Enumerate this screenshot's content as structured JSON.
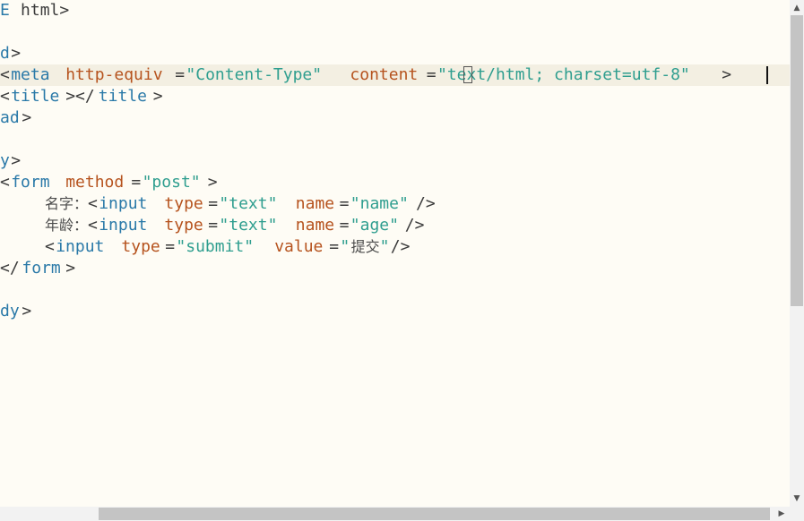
{
  "editor": {
    "lines": [
      [
        {
          "c": "c-tag",
          "t": "E"
        },
        {
          "c": "c-dark",
          "t": " html>"
        }
      ],
      [],
      [
        {
          "c": "c-tag",
          "t": "d"
        },
        {
          "c": "c-dark",
          "t": ">"
        }
      ],
      [
        {
          "c": "c-dark",
          "t": "<"
        },
        {
          "c": "c-tag",
          "t": "meta"
        },
        {
          "c": "c-dark",
          "t": " "
        },
        {
          "c": "c-attr",
          "t": "http-equiv"
        },
        {
          "c": "c-dark",
          "t": "="
        },
        {
          "c": "c-str",
          "t": "\"Content-Type\""
        },
        {
          "c": "c-dark",
          "t": " "
        },
        {
          "c": "c-attr",
          "t": "content"
        },
        {
          "c": "c-dark",
          "t": "="
        },
        {
          "c": "c-str",
          "t": "\"text/html; charset=utf-8\""
        },
        {
          "c": "c-dark",
          "t": ">"
        }
      ],
      [
        {
          "c": "c-dark",
          "t": "<"
        },
        {
          "c": "c-tag",
          "t": "title"
        },
        {
          "c": "c-dark",
          "t": "></"
        },
        {
          "c": "c-tag",
          "t": "title"
        },
        {
          "c": "c-dark",
          "t": ">"
        }
      ],
      [
        {
          "c": "c-tag",
          "t": "ad"
        },
        {
          "c": "c-dark",
          "t": ">"
        }
      ],
      [],
      [
        {
          "c": "c-tag",
          "t": "y"
        },
        {
          "c": "c-dark",
          "t": ">"
        }
      ],
      [
        {
          "c": "c-dark",
          "t": "<"
        },
        {
          "c": "c-tag",
          "t": "form"
        },
        {
          "c": "c-dark",
          "t": " "
        },
        {
          "c": "c-attr",
          "t": "method"
        },
        {
          "c": "c-dark",
          "t": "="
        },
        {
          "c": "c-str",
          "t": "\"post\""
        },
        {
          "c": "c-dark",
          "t": ">"
        }
      ],
      [
        {
          "c": "c-cjk",
          "t": "名字："
        },
        {
          "c": "c-dark",
          "t": "<"
        },
        {
          "c": "c-tag",
          "t": "input"
        },
        {
          "c": "c-dark",
          "t": " "
        },
        {
          "c": "c-attr",
          "t": "type"
        },
        {
          "c": "c-dark",
          "t": "="
        },
        {
          "c": "c-str",
          "t": "\"text\""
        },
        {
          "c": "c-dark",
          "t": " "
        },
        {
          "c": "c-attr",
          "t": "name"
        },
        {
          "c": "c-dark",
          "t": "="
        },
        {
          "c": "c-str",
          "t": "\"name\""
        },
        {
          "c": "c-dark",
          "t": "/>"
        }
      ],
      [
        {
          "c": "c-cjk",
          "t": "年龄："
        },
        {
          "c": "c-dark",
          "t": "<"
        },
        {
          "c": "c-tag",
          "t": "input"
        },
        {
          "c": "c-dark",
          "t": " "
        },
        {
          "c": "c-attr",
          "t": "type"
        },
        {
          "c": "c-dark",
          "t": "="
        },
        {
          "c": "c-str",
          "t": "\"text\""
        },
        {
          "c": "c-dark",
          "t": " "
        },
        {
          "c": "c-attr",
          "t": "name"
        },
        {
          "c": "c-dark",
          "t": "="
        },
        {
          "c": "c-str",
          "t": "\"age\""
        },
        {
          "c": "c-dark",
          "t": "/>"
        }
      ],
      [
        {
          "c": "c-dark",
          "t": "<"
        },
        {
          "c": "c-tag",
          "t": "input"
        },
        {
          "c": "c-dark",
          "t": " "
        },
        {
          "c": "c-attr",
          "t": "type"
        },
        {
          "c": "c-dark",
          "t": "="
        },
        {
          "c": "c-str",
          "t": "\"submit\""
        },
        {
          "c": "c-dark",
          "t": " "
        },
        {
          "c": "c-attr",
          "t": "value"
        },
        {
          "c": "c-dark",
          "t": "="
        },
        {
          "c": "c-str",
          "t": "\""
        },
        {
          "c": "c-cjk",
          "t": "提交"
        },
        {
          "c": "c-str",
          "t": "\""
        },
        {
          "c": "c-dark",
          "t": "/>"
        }
      ],
      [
        {
          "c": "c-dark",
          "t": "</"
        },
        {
          "c": "c-tag",
          "t": "form"
        },
        {
          "c": "c-dark",
          "t": ">"
        }
      ],
      [],
      [
        {
          "c": "c-tag",
          "t": "dy"
        },
        {
          "c": "c-dark",
          "t": ">"
        }
      ]
    ],
    "cursor_line": 4
  },
  "scrollbars": {
    "up_arrow": "▲",
    "down_arrow": "▼",
    "right_arrow": "▶"
  },
  "colors": {
    "background": "#fefcf5",
    "current_line": "#f3efe2",
    "tag": "#2a79a8",
    "attribute": "#b6531e",
    "string": "#2f9e8f",
    "punctuation": "#3b3b3b"
  }
}
